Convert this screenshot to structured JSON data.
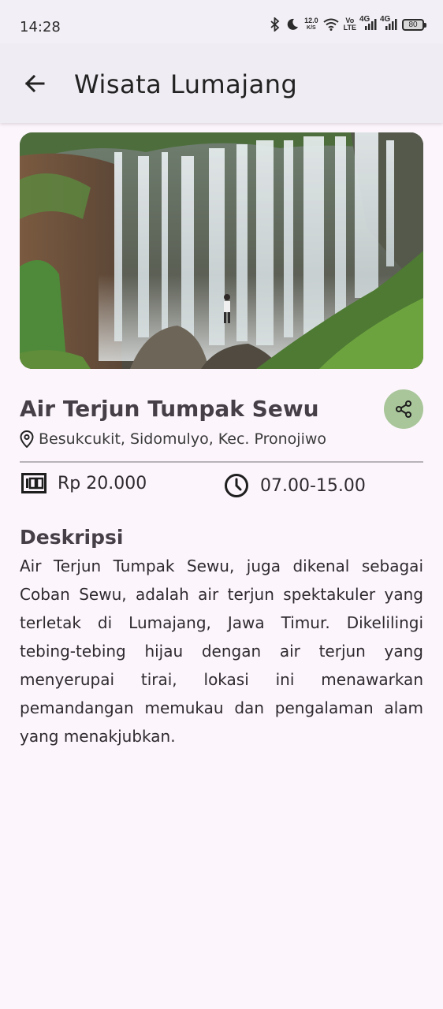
{
  "status_bar": {
    "time": "14:28",
    "net_speed_value": "12.0",
    "net_speed_unit": "K/S",
    "volte_top": "Vo",
    "volte_bottom": "LTE",
    "signal1_label": "4G",
    "signal2_label": "4G",
    "battery": "80",
    "icons": [
      "bluetooth-icon",
      "moon-icon",
      "wifi-icon",
      "signal-icon",
      "signal-icon",
      "battery-icon"
    ]
  },
  "app_bar": {
    "title": "Wisata Lumajang",
    "back_icon": "arrow-left-icon"
  },
  "place": {
    "title": "Air Terjun Tumpak Sewu",
    "location": "Besukcukit, Sidomulyo, Kec. Pronojiwo",
    "price": "Rp 20.000",
    "hours": "07.00-15.00",
    "accent_color": "#a9c59a"
  },
  "description": {
    "heading": "Deskripsi",
    "body": "Air Terjun Tumpak Sewu, juga dikenal sebagai Coban Sewu, adalah air terjun spektakuler yang terletak di Lumajang, Jawa Timur. Dikelilingi tebing-tebing hijau dengan air terjun yang menyerupai tirai, lokasi ini menawarkan pemandangan memukau dan pengalaman alam yang menakjubkan."
  }
}
